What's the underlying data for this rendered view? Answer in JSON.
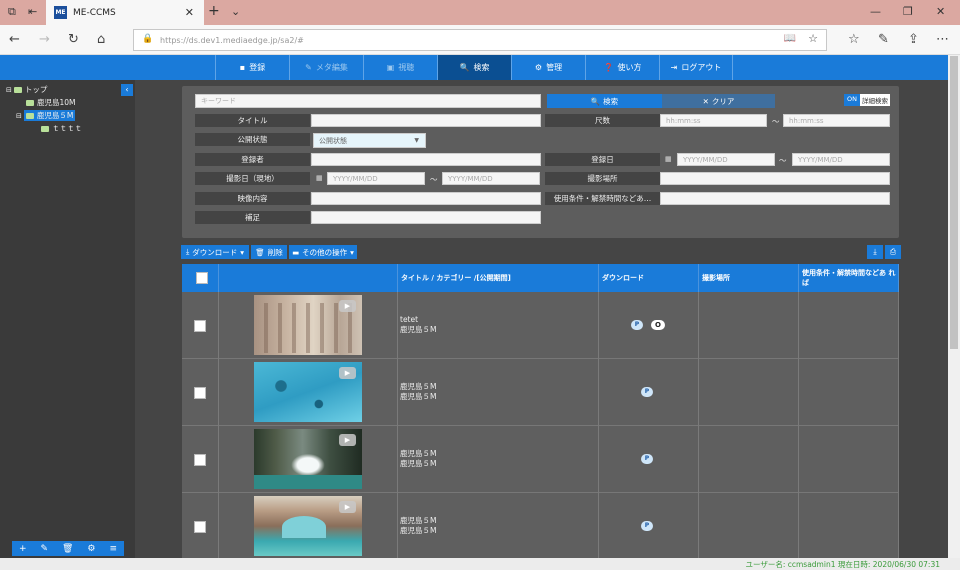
{
  "browser": {
    "tab_title": "ME-CCMS",
    "favicon_text": "ME",
    "url": "https://ds.dev1.mediaedge.jp/sa2/#"
  },
  "nav": {
    "items": [
      {
        "label": "登録",
        "icon": "register-icon"
      },
      {
        "label": "メタ編集",
        "icon": "pencil-icon"
      },
      {
        "label": "視聴",
        "icon": "play-icon"
      },
      {
        "label": "検索",
        "icon": "search-icon"
      },
      {
        "label": "管理",
        "icon": "gear-icon"
      },
      {
        "label": "使い方",
        "icon": "help-icon"
      },
      {
        "label": "ログアウト",
        "icon": "logout-icon"
      }
    ]
  },
  "tree": {
    "root": "トップ",
    "children": [
      "鹿児島10M",
      "鹿児島５M"
    ],
    "grandchild": "ｔｔｔｔ"
  },
  "search": {
    "keyword_placeholder": "キーワード",
    "search_label": "検索",
    "clear_label": "クリア",
    "toggle_on": "ON",
    "toggle_label": "詳細検索",
    "title_label": "タイトル",
    "length_label": "尺数",
    "time_placeholder": "hh:mm:ss",
    "tilde": "〜",
    "status_label": "公開状態",
    "status_value": "公開状態",
    "registrant_label": "登録者",
    "registered_date_label": "登録日",
    "date_placeholder": "YYYY/MM/DD",
    "shoot_date_label": "撮影日（現地）",
    "shoot_place_label": "撮影場所",
    "content_label": "映像内容",
    "terms_label": "使用条件・解禁時間などあ…",
    "note_label": "補足"
  },
  "toolbar": {
    "download_label": "ダウンロード",
    "delete_label": "削除",
    "other_label": "その他の操作"
  },
  "table": {
    "headers": [
      "タイトル / カテゴリー /[公開期間]",
      "ダウンロード",
      "撮影場所",
      "使用条件・解禁時間などあ れば"
    ],
    "rows": [
      {
        "title": "tetet",
        "category": "鹿児島５M",
        "badges": [
          "P",
          "O"
        ]
      },
      {
        "title": "鹿児島５M",
        "category": "鹿児島５M",
        "badges": [
          "P"
        ]
      },
      {
        "title": "鹿児島５M",
        "category": "鹿児島５M",
        "badges": [
          "P"
        ]
      },
      {
        "title": "鹿児島５M",
        "category": "鹿児島５M",
        "badges": [
          "P"
        ]
      }
    ]
  },
  "status": {
    "text": "ユーザー名: ccmsadmin1  現在日時: 2020/06/30 07:31"
  }
}
